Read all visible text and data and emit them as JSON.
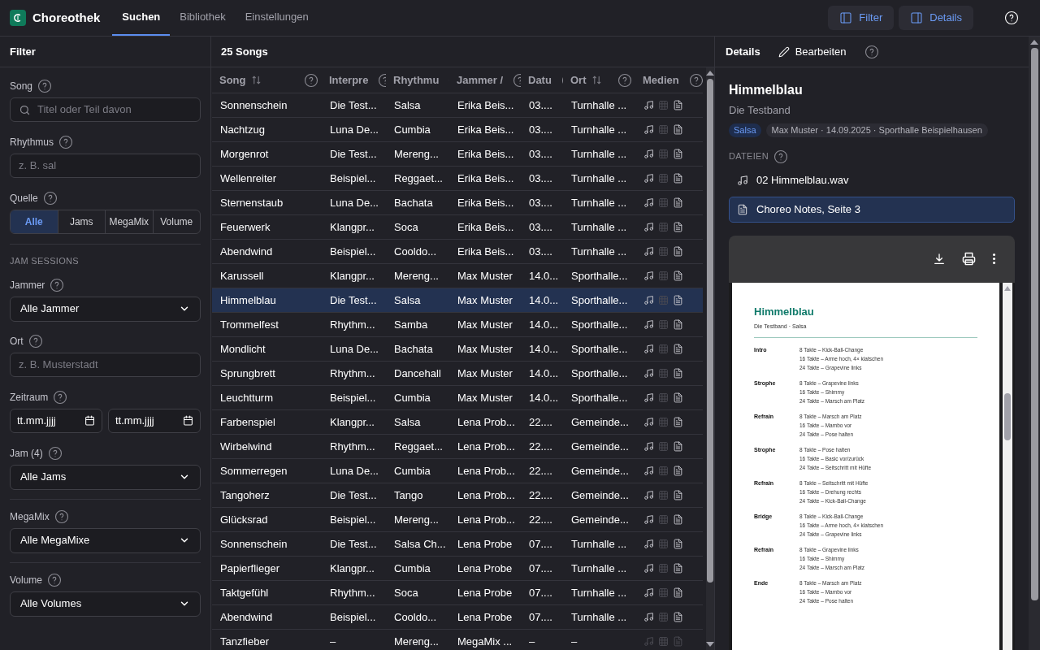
{
  "app": {
    "name": "Choreothek"
  },
  "tabs": [
    {
      "label": "Suchen",
      "selected": true
    },
    {
      "label": "Bibliothek",
      "selected": false
    },
    {
      "label": "Einstellungen",
      "selected": false
    }
  ],
  "toggles": [
    {
      "label": "Filter",
      "kind": "left",
      "on": true
    },
    {
      "label": "Details",
      "kind": "right",
      "on": true
    }
  ],
  "filter": {
    "title": "Filter",
    "song": {
      "label": "Song",
      "placeholder": "Titel oder Teil davon"
    },
    "rhythm": {
      "label": "Rhythmus",
      "placeholder": "z. B. sal"
    },
    "source": {
      "label": "Quelle",
      "options": [
        {
          "label": "Alle",
          "selected": true
        },
        {
          "label": "Jams",
          "selected": false
        },
        {
          "label": "MegaMix",
          "selected": false
        },
        {
          "label": "Volume",
          "selected": false
        }
      ]
    },
    "section": "JAM SESSIONS",
    "jammer": {
      "label": "Jammer",
      "value": "Alle Jammer"
    },
    "place": {
      "label": "Ort",
      "placeholder": "z. B. Musterstadt"
    },
    "range": {
      "label": "Zeitraum",
      "from": "tt.mm.jjjj",
      "to": "tt.mm.jjjj"
    },
    "jam": {
      "label": "Jam (4)",
      "value": "Alle Jams"
    },
    "megamix": {
      "label": "MegaMix",
      "value": "Alle MegaMixe"
    },
    "volume": {
      "label": "Volume",
      "value": "Alle Volumes"
    }
  },
  "table": {
    "count": "25 Songs",
    "columns": [
      {
        "label": "Song",
        "sortable": true
      },
      {
        "label": "Interpre",
        "sortable": false
      },
      {
        "label": "Rhythmu",
        "sortable": false
      },
      {
        "label": "Jammer /",
        "sortable": false
      },
      {
        "label": "Datu",
        "sortable": false
      },
      {
        "label": "Ort",
        "sortable": true
      },
      {
        "label": "Medien",
        "sortable": false
      }
    ],
    "rows": [
      {
        "cells": [
          "Sonnenschein",
          "Die Test...",
          "Salsa",
          "Erika Beis...",
          "03....",
          "Turnhalle ..."
        ],
        "selected": false,
        "audio": true,
        "video": false,
        "notes": true
      },
      {
        "cells": [
          "Nachtzug",
          "Luna De...",
          "Cumbia",
          "Erika Beis...",
          "03....",
          "Turnhalle ..."
        ],
        "selected": false,
        "audio": true,
        "video": false,
        "notes": true
      },
      {
        "cells": [
          "Morgenrot",
          "Die Test...",
          "Mereng...",
          "Erika Beis...",
          "03....",
          "Turnhalle ..."
        ],
        "selected": false,
        "audio": true,
        "video": false,
        "notes": true
      },
      {
        "cells": [
          "Wellenreiter",
          "Beispiel...",
          "Reggaet...",
          "Erika Beis...",
          "03....",
          "Turnhalle ..."
        ],
        "selected": false,
        "audio": true,
        "video": false,
        "notes": true
      },
      {
        "cells": [
          "Sternenstaub",
          "Luna De...",
          "Bachata",
          "Erika Beis...",
          "03....",
          "Turnhalle ..."
        ],
        "selected": false,
        "audio": true,
        "video": false,
        "notes": true
      },
      {
        "cells": [
          "Feuerwerk",
          "Klangpr...",
          "Soca",
          "Erika Beis...",
          "03....",
          "Turnhalle ..."
        ],
        "selected": false,
        "audio": true,
        "video": false,
        "notes": true
      },
      {
        "cells": [
          "Abendwind",
          "Beispiel...",
          "Cooldo...",
          "Erika Beis...",
          "03....",
          "Turnhalle ..."
        ],
        "selected": false,
        "audio": true,
        "video": false,
        "notes": true
      },
      {
        "cells": [
          "Karussell",
          "Klangpr...",
          "Mereng...",
          "Max Muster",
          "14.0...",
          "Sporthalle..."
        ],
        "selected": false,
        "audio": true,
        "video": false,
        "notes": true
      },
      {
        "cells": [
          "Himmelblau",
          "Die Test...",
          "Salsa",
          "Max Muster",
          "14.0...",
          "Sporthalle..."
        ],
        "selected": true,
        "audio": true,
        "video": false,
        "notes": true
      },
      {
        "cells": [
          "Trommelfest",
          "Rhythm...",
          "Samba",
          "Max Muster",
          "14.0...",
          "Sporthalle..."
        ],
        "selected": false,
        "audio": true,
        "video": false,
        "notes": true
      },
      {
        "cells": [
          "Mondlicht",
          "Luna De...",
          "Bachata",
          "Max Muster",
          "14.0...",
          "Sporthalle..."
        ],
        "selected": false,
        "audio": true,
        "video": false,
        "notes": true
      },
      {
        "cells": [
          "Sprungbrett",
          "Rhythm...",
          "Dancehall",
          "Max Muster",
          "14.0...",
          "Sporthalle..."
        ],
        "selected": false,
        "audio": true,
        "video": false,
        "notes": true
      },
      {
        "cells": [
          "Leuchtturm",
          "Beispiel...",
          "Cumbia",
          "Max Muster",
          "14.0...",
          "Sporthalle..."
        ],
        "selected": false,
        "audio": true,
        "video": false,
        "notes": true
      },
      {
        "cells": [
          "Farbenspiel",
          "Klangpr...",
          "Salsa",
          "Lena Prob...",
          "22....",
          "Gemeinde..."
        ],
        "selected": false,
        "audio": true,
        "video": false,
        "notes": true
      },
      {
        "cells": [
          "Wirbelwind",
          "Rhythm...",
          "Reggaet...",
          "Lena Prob...",
          "22....",
          "Gemeinde..."
        ],
        "selected": false,
        "audio": true,
        "video": false,
        "notes": true
      },
      {
        "cells": [
          "Sommerregen",
          "Luna De...",
          "Cumbia",
          "Lena Prob...",
          "22....",
          "Gemeinde..."
        ],
        "selected": false,
        "audio": true,
        "video": false,
        "notes": true
      },
      {
        "cells": [
          "Tangoherz",
          "Die Test...",
          "Tango",
          "Lena Prob...",
          "22....",
          "Gemeinde..."
        ],
        "selected": false,
        "audio": true,
        "video": false,
        "notes": true
      },
      {
        "cells": [
          "Glücksrad",
          "Beispiel...",
          "Mereng...",
          "Lena Prob...",
          "22....",
          "Gemeinde..."
        ],
        "selected": false,
        "audio": true,
        "video": false,
        "notes": true
      },
      {
        "cells": [
          "Sonnenschein",
          "Die Test...",
          "Salsa Ch...",
          "Lena Probe",
          "07....",
          "Turnhalle ..."
        ],
        "selected": false,
        "audio": true,
        "video": false,
        "notes": true
      },
      {
        "cells": [
          "Papierflieger",
          "Klangpr...",
          "Cumbia",
          "Lena Probe",
          "07....",
          "Turnhalle ..."
        ],
        "selected": false,
        "audio": true,
        "video": false,
        "notes": true
      },
      {
        "cells": [
          "Taktgefühl",
          "Rhythm...",
          "Soca",
          "Lena Probe",
          "07....",
          "Turnhalle ..."
        ],
        "selected": false,
        "audio": true,
        "video": false,
        "notes": true
      },
      {
        "cells": [
          "Abendwind",
          "Beispiel...",
          "Cooldo...",
          "Lena Probe",
          "07....",
          "Turnhalle ..."
        ],
        "selected": false,
        "audio": true,
        "video": false,
        "notes": true
      },
      {
        "cells": [
          "Tanzfieber",
          "–",
          "Mereng...",
          "MegaMix ...",
          "–",
          "–"
        ],
        "selected": false,
        "audio": false,
        "video": false,
        "notes": false
      }
    ]
  },
  "details": {
    "title": "Details",
    "edit": "Bearbeiten",
    "song": "Himmelblau",
    "artist": "Die Testband",
    "rhythm_tag": "Salsa",
    "meta_tag": "Max Muster · 14.09.2025 · Sporthalle Beispielhausen",
    "files_label": "DATEIEN",
    "files": [
      {
        "kind": "audio",
        "name": "02 Himmelblau.wav",
        "selected": false
      },
      {
        "kind": "notes",
        "name": "Choreo Notes, Seite 3",
        "selected": true
      }
    ],
    "document": {
      "title": "Himmelblau",
      "subtitle": "Die Testband · Salsa",
      "sections": [
        {
          "name": "Intro",
          "lines": [
            "8 Takte – Kick-Ball-Change",
            "16 Takte – Arme hoch, 4× klatschen",
            "24 Takte – Grapevine links"
          ]
        },
        {
          "name": "Strophe",
          "lines": [
            "8 Takte – Grapevine links",
            "16 Takte – Shimmy",
            "24 Takte – Marsch am Platz"
          ]
        },
        {
          "name": "Refrain",
          "lines": [
            "8 Takte – Marsch am Platz",
            "16 Takte – Mambo vor",
            "24 Takte – Pose halten"
          ]
        },
        {
          "name": "Strophe",
          "lines": [
            "8 Takte – Pose halten",
            "16 Takte – Basic vor/zurück",
            "24 Takte – Seitschritt mit Hüfte"
          ]
        },
        {
          "name": "Refrain",
          "lines": [
            "8 Takte – Seitschritt mit Hüfte",
            "16 Takte – Drehung rechts",
            "24 Takte – Kick-Ball-Change"
          ]
        },
        {
          "name": "Bridge",
          "lines": [
            "8 Takte – Kick-Ball-Change",
            "16 Takte – Arme hoch, 4× klatschen",
            "24 Takte – Grapevine links"
          ]
        },
        {
          "name": "Refrain",
          "lines": [
            "8 Takte – Grapevine links",
            "16 Takte – Shimmy",
            "24 Takte – Marsch am Platz"
          ]
        },
        {
          "name": "Ende",
          "lines": [
            "8 Takte – Marsch am Platz",
            "16 Takte – Mambo vor",
            "24 Takte – Pose halten"
          ]
        }
      ]
    }
  }
}
